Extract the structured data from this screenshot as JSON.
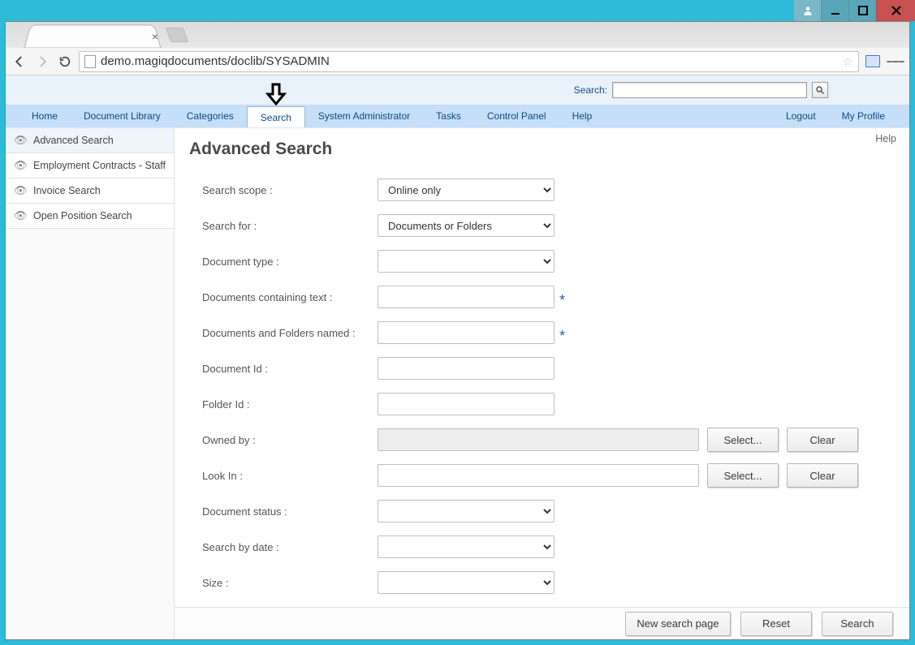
{
  "window": {
    "profile_icon": "profile"
  },
  "browser": {
    "url": "demo.magiqdocuments/doclib/SYSADMIN"
  },
  "top_search": {
    "label": "Search:",
    "value": ""
  },
  "menu": {
    "items": [
      "Home",
      "Document Library",
      "Categories",
      "Search",
      "System Administrator",
      "Tasks",
      "Control Panel",
      "Help"
    ],
    "right_items": [
      "Logout",
      "My Profile"
    ],
    "active_index": 3
  },
  "sidebar": {
    "items": [
      {
        "label": "Advanced Search"
      },
      {
        "label": "Employment Contracts - Staff"
      },
      {
        "label": "Invoice Search"
      },
      {
        "label": "Open Position Search"
      }
    ]
  },
  "page": {
    "title": "Advanced Search",
    "help_link": "Help"
  },
  "form": {
    "search_scope": {
      "label": "Search scope :",
      "value": "Online only"
    },
    "search_for": {
      "label": "Search for :",
      "value": "Documents or Folders"
    },
    "document_type": {
      "label": "Document type :",
      "value": ""
    },
    "containing_text": {
      "label": "Documents containing text :",
      "value": ""
    },
    "docs_folders_named": {
      "label": "Documents and Folders named :",
      "value": ""
    },
    "document_id": {
      "label": "Document Id :",
      "value": ""
    },
    "folder_id": {
      "label": "Folder Id :",
      "value": ""
    },
    "owned_by": {
      "label": "Owned by :",
      "value": "",
      "select_btn": "Select...",
      "clear_btn": "Clear"
    },
    "look_in": {
      "label": "Look In :",
      "value": "",
      "select_btn": "Select...",
      "clear_btn": "Clear"
    },
    "document_status": {
      "label": "Document status :",
      "value": ""
    },
    "search_by_date": {
      "label": "Search by date :",
      "value": ""
    },
    "size": {
      "label": "Size :",
      "value": ""
    }
  },
  "footer": {
    "new_search": "New search page",
    "reset": "Reset",
    "search": "Search"
  }
}
